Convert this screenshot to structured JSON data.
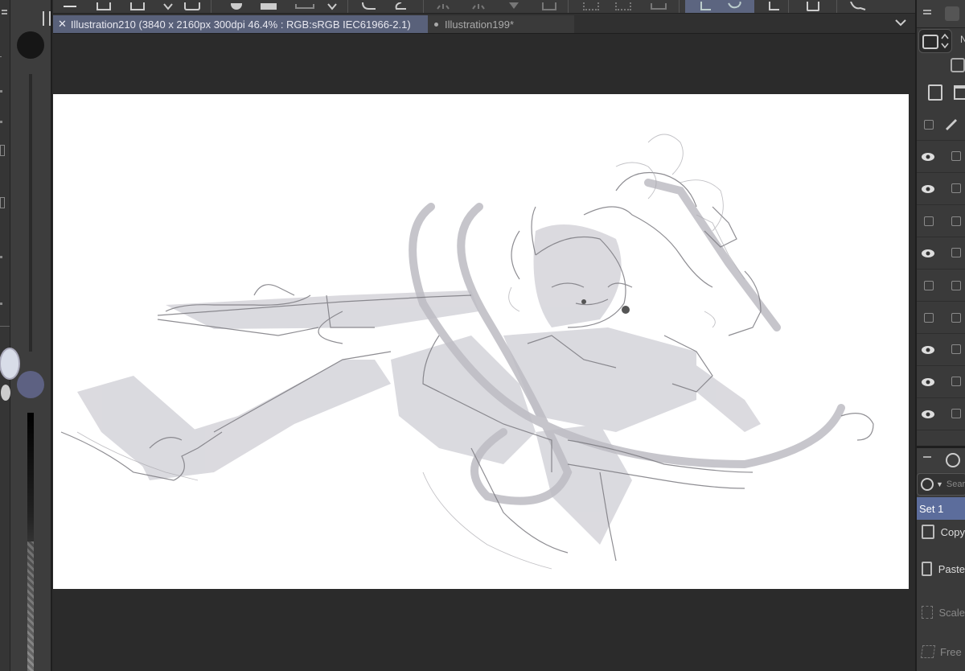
{
  "tabs": [
    {
      "label": "Illustration210 (3840 x 2160px 300dpi 46.4% : RGB:sRGB IEC61966-2.1)",
      "active": true
    },
    {
      "label": "Illustration199*",
      "active": false
    }
  ],
  "right_panel": {
    "partial_label": "N",
    "search_placeholder": "Sear",
    "set_label": "Set 1",
    "actions": [
      {
        "label": "Copy",
        "icon": "copy-icon"
      },
      {
        "label": "Paste",
        "icon": "paste-icon"
      },
      {
        "label": "Scale",
        "icon": "scale-icon"
      },
      {
        "label": "Free",
        "icon": "free-transform-icon"
      }
    ],
    "layers": [
      {
        "visible": false
      },
      {
        "visible": true
      },
      {
        "visible": true
      },
      {
        "visible": false
      },
      {
        "visible": true
      },
      {
        "visible": false
      },
      {
        "visible": false
      },
      {
        "visible": true
      },
      {
        "visible": true
      },
      {
        "visible": true
      }
    ]
  },
  "colors": {
    "canvas": "#ffffff",
    "workspace": "#2b2b2b",
    "active_tab": "#59617a",
    "selection": "#5c6d9c",
    "sub_color": "#5d6182"
  }
}
